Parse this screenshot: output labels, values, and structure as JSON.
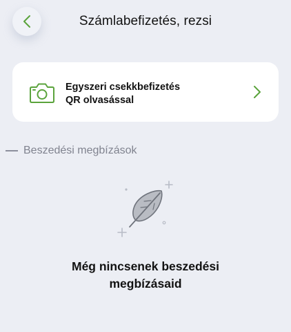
{
  "header": {
    "title": "Számlabefizetés, rezsi",
    "back_icon": "chevron-left-icon"
  },
  "qr_card": {
    "line1": "Egyszeri csekkbefizetés",
    "line2": "QR olvasással",
    "icon": "camera-icon",
    "trailing_icon": "chevron-right-icon"
  },
  "section": {
    "title": "Beszedési megbízások"
  },
  "empty_state": {
    "icon": "feather-icon",
    "line1": "Még nincsenek beszedési",
    "line2": "megbízásaid"
  },
  "colors": {
    "accent": "#5aa33b",
    "background": "#eceef4",
    "card": "#ffffff",
    "muted_text": "#80838f"
  }
}
